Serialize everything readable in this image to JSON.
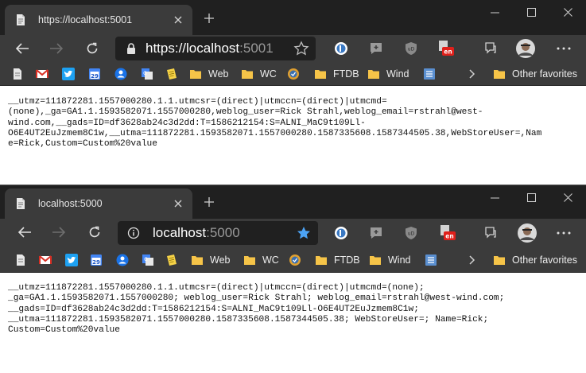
{
  "colors": {
    "titlebar": "#202020",
    "toolbar": "#3b3b3b",
    "address_bg": "#202020",
    "gmail_red": "#d93025",
    "twitter_blue": "#1da1f2",
    "folder_yellow": "#f6c448",
    "star_blue": "#4ca3f5",
    "badge_red": "#e0201b"
  },
  "windows": [
    {
      "tab_title": "https://localhost:5001",
      "address": {
        "scheme": "https://",
        "host": "localhost",
        "port": ":5001"
      },
      "favorited": false,
      "content_lines": [
        "__utmz=111872281.1557000280.1.1.utmcsr=(direct)|utmccn=(direct)|utmcmd=",
        "(none),_ga=GA1.1.1593582071.1557000280,weblog_user=Rick Strahl,weblog_email=rstrahl@west-",
        "wind.com,__gads=ID=df3628ab24c3d2dd:T=1586212154:S=ALNI_MaC9t109Ll-",
        "O6E4UT2EuJzmem8C1w,__utma=111872281.1593582071.1557000280.1587335608.1587344505.38,WebStoreUser=,Nam",
        "e=Rick,Custom=Custom%20value"
      ]
    },
    {
      "tab_title": "localhost:5000",
      "address": {
        "scheme": "",
        "host": "localhost",
        "port": ":5000"
      },
      "favorited": true,
      "content_lines": [
        "__utmz=111872281.1557000280.1.1.utmcsr=(direct)|utmccn=(direct)|utmcmd=(none);",
        "_ga=GA1.1.1593582071.1557000280; weblog_user=Rick Strahl; weblog_email=rstrahl@west-wind.com;",
        "__gads=ID=df3628ab24c3d2dd:T=1586212154:S=ALNI_MaC9t109Ll-O6E4UT2EuJzmem8C1w;",
        "__utma=111872281.1593582071.1557000280.1587335608.1587344505.38; WebStoreUser=; Name=Rick;",
        "Custom=Custom%20value"
      ]
    }
  ],
  "bookmarks": {
    "web": "Web",
    "wc": "WC",
    "ftdb": "FTDB",
    "wind": "Wind",
    "other_favorites": "Other favorites",
    "calendar_day": "29"
  },
  "extensions": {
    "badge_text": "en",
    "ublock_label": "uD"
  },
  "icons": [
    "page-icon",
    "close-icon",
    "plus-icon",
    "minimize-icon",
    "maximize-icon",
    "back-arrow-icon",
    "forward-arrow-icon",
    "refresh-icon",
    "lock-icon",
    "info-icon",
    "star-icon",
    "gmail-icon",
    "twitter-icon",
    "calendar-icon",
    "user-icon",
    "translate-icon",
    "notepad-icon",
    "folder-icon",
    "chevron-right-icon",
    "more-icon"
  ]
}
